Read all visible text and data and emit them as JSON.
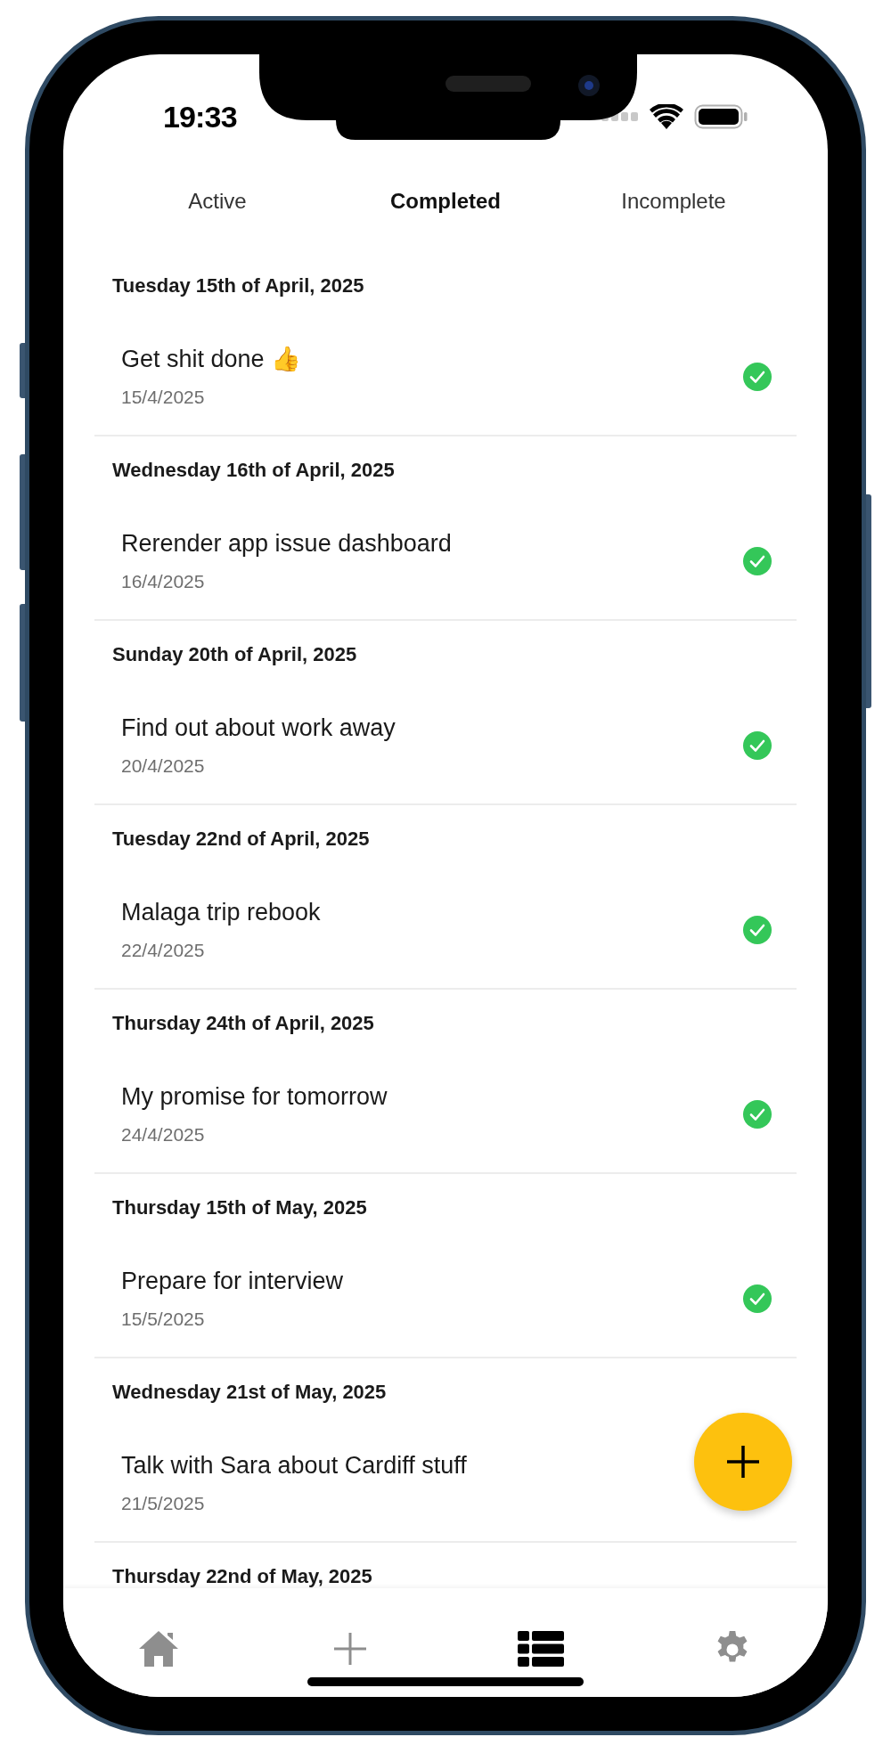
{
  "status_bar": {
    "time": "19:33"
  },
  "tabs": [
    {
      "label": "Active",
      "selected": false
    },
    {
      "label": "Completed",
      "selected": true
    },
    {
      "label": "Incomplete",
      "selected": false
    }
  ],
  "sections": [
    {
      "date": "Tuesday 15th of April, 2025",
      "tasks": [
        {
          "title": "Get shit done 👍",
          "date": "15/4/2025",
          "completed": true
        }
      ]
    },
    {
      "date": "Wednesday 16th of April, 2025",
      "tasks": [
        {
          "title": "Rerender app issue dashboard",
          "date": "16/4/2025",
          "completed": true
        }
      ]
    },
    {
      "date": "Sunday 20th of April, 2025",
      "tasks": [
        {
          "title": "Find out about work away",
          "date": "20/4/2025",
          "completed": true
        }
      ]
    },
    {
      "date": "Tuesday 22nd of April, 2025",
      "tasks": [
        {
          "title": "Malaga trip rebook",
          "date": "22/4/2025",
          "completed": true
        }
      ]
    },
    {
      "date": "Thursday 24th of April, 2025",
      "tasks": [
        {
          "title": "My promise for tomorrow",
          "date": "24/4/2025",
          "completed": true
        }
      ]
    },
    {
      "date": "Thursday 15th of May, 2025",
      "tasks": [
        {
          "title": "Prepare for interview",
          "date": "15/5/2025",
          "completed": true
        }
      ]
    },
    {
      "date": "Wednesday 21st of May, 2025",
      "tasks": [
        {
          "title": "Talk with Sara about Cardiff stuff",
          "date": "21/5/2025"
        }
      ]
    },
    {
      "date": "Thursday 22nd of May, 2025"
    }
  ],
  "nav": [
    {
      "kind": "home",
      "selected": false
    },
    {
      "kind": "add",
      "selected": false
    },
    {
      "kind": "list",
      "selected": true
    },
    {
      "kind": "settings",
      "selected": false
    }
  ]
}
